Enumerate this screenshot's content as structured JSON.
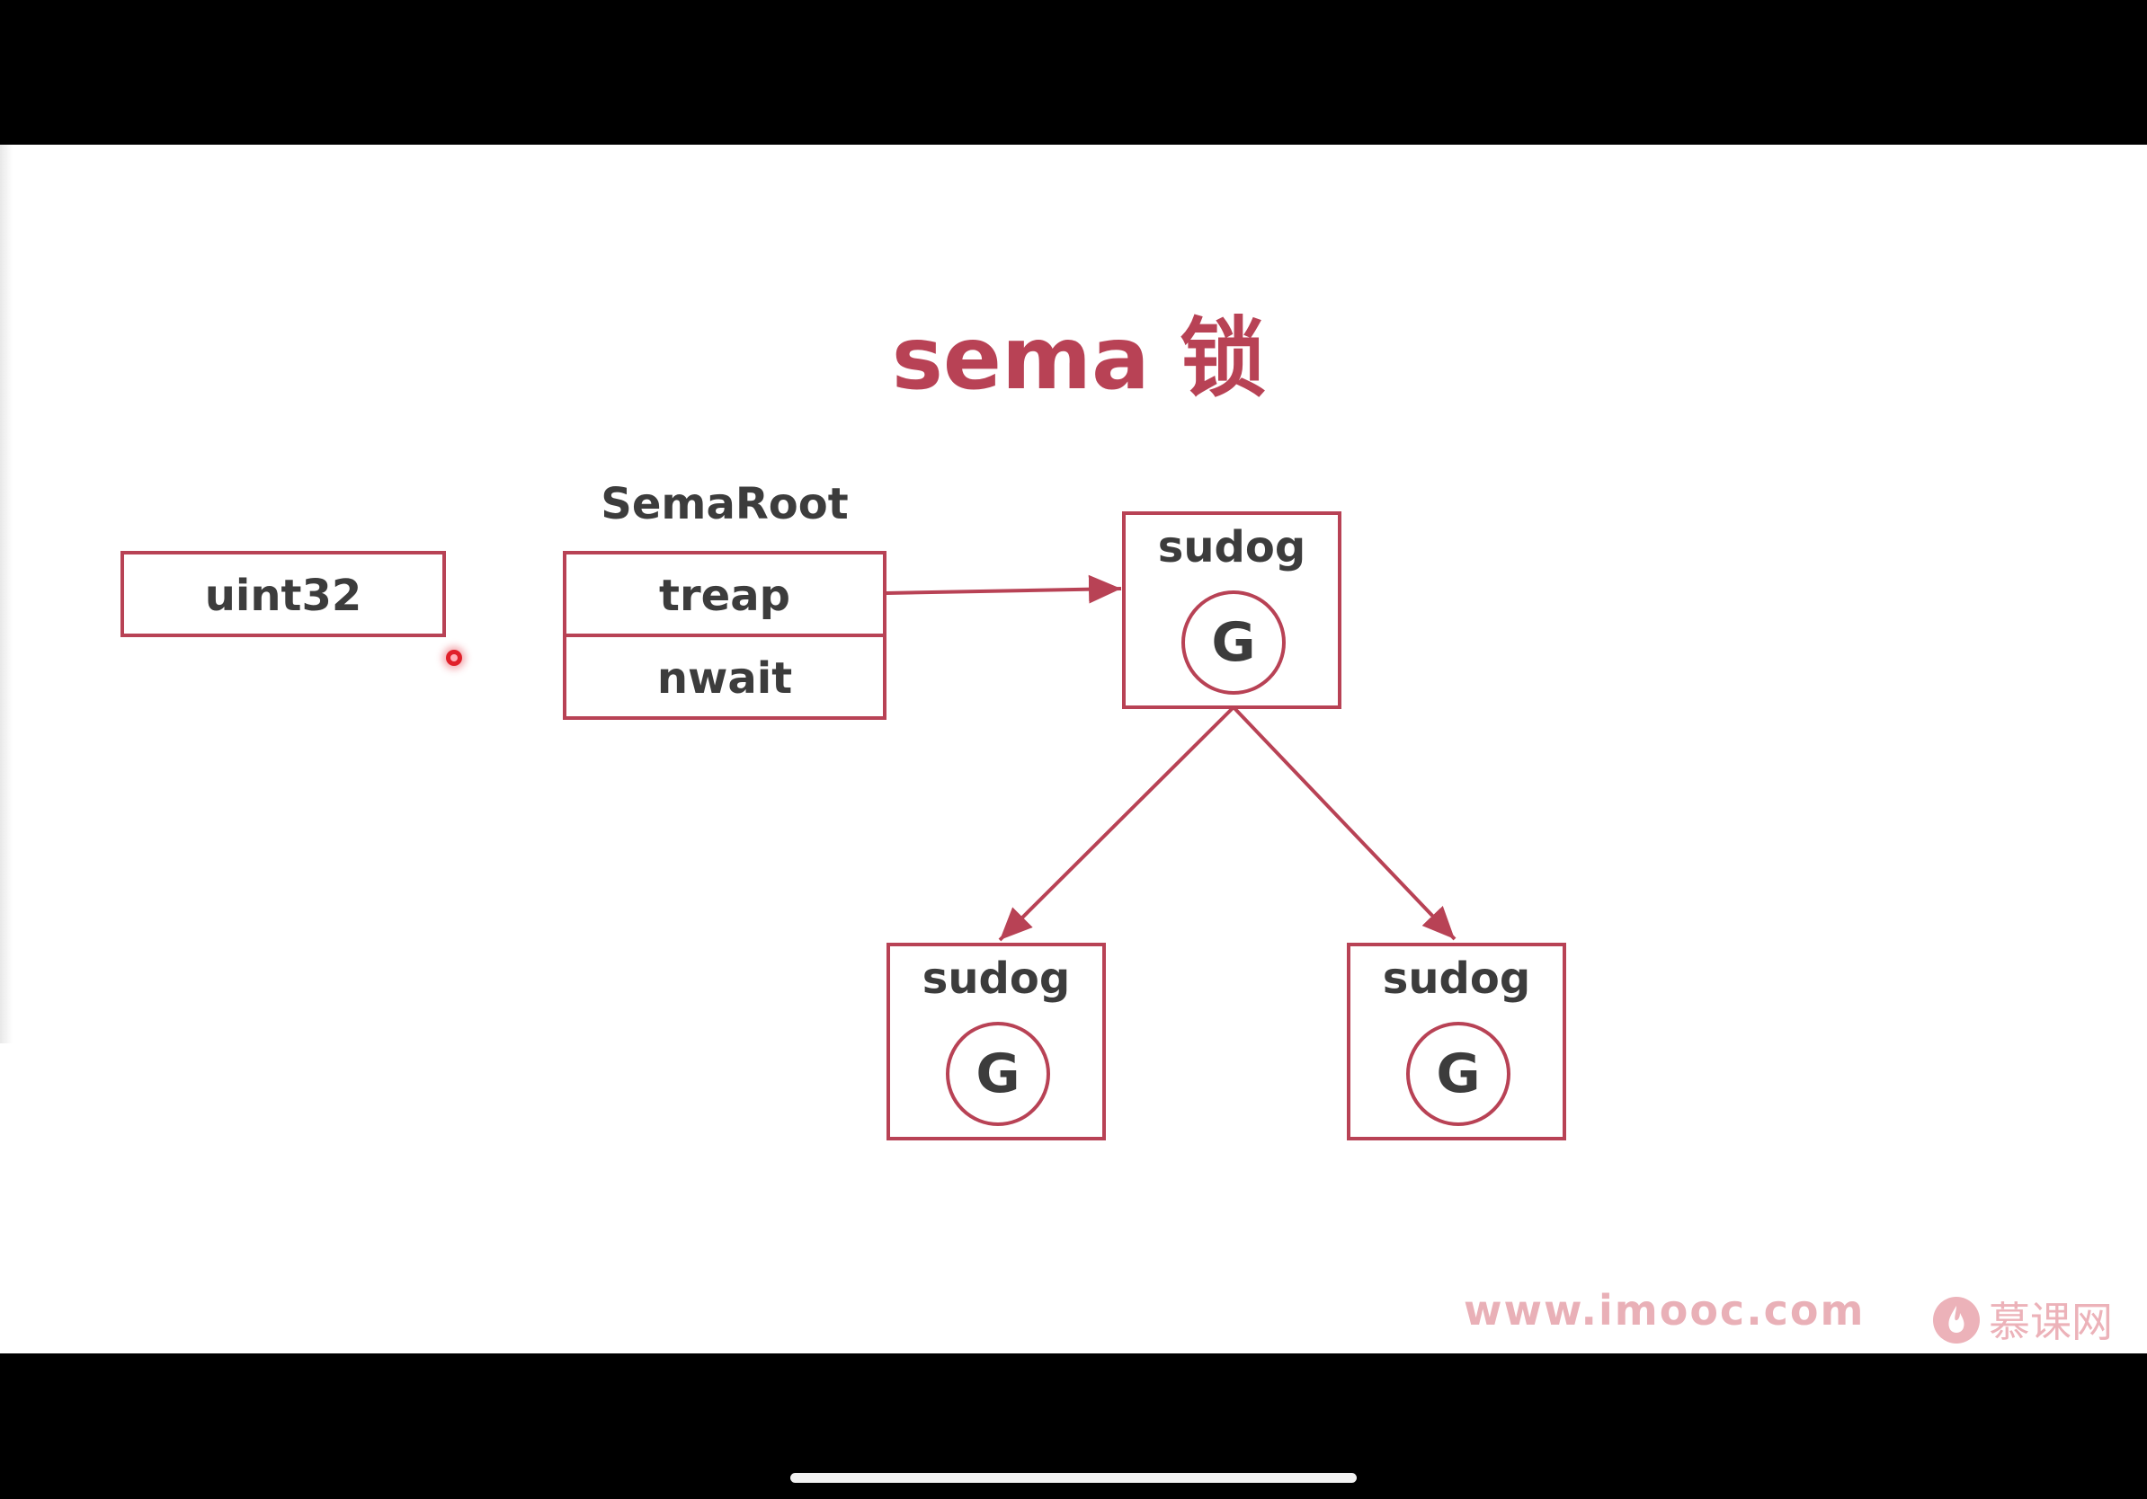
{
  "title": "sema 锁",
  "nodes": {
    "uint32": {
      "label": "uint32"
    },
    "semaroot": {
      "heading": "SemaRoot",
      "fields": [
        "treap",
        "nwait"
      ]
    },
    "sudog_root": {
      "label": "sudog",
      "inner": "G"
    },
    "sudog_left": {
      "label": "sudog",
      "inner": "G"
    },
    "sudog_right": {
      "label": "sudog",
      "inner": "G"
    }
  },
  "edges": [
    {
      "from": "semaroot.treap",
      "to": "sudog_root"
    },
    {
      "from": "sudog_root",
      "to": "sudog_left"
    },
    {
      "from": "sudog_root",
      "to": "sudog_right"
    }
  ],
  "watermark": {
    "url": "www.imooc.com",
    "brand": "慕课网"
  },
  "colors": {
    "accent": "#b84255",
    "text": "#3c3c3c",
    "watermark": "#e9b0b7"
  }
}
